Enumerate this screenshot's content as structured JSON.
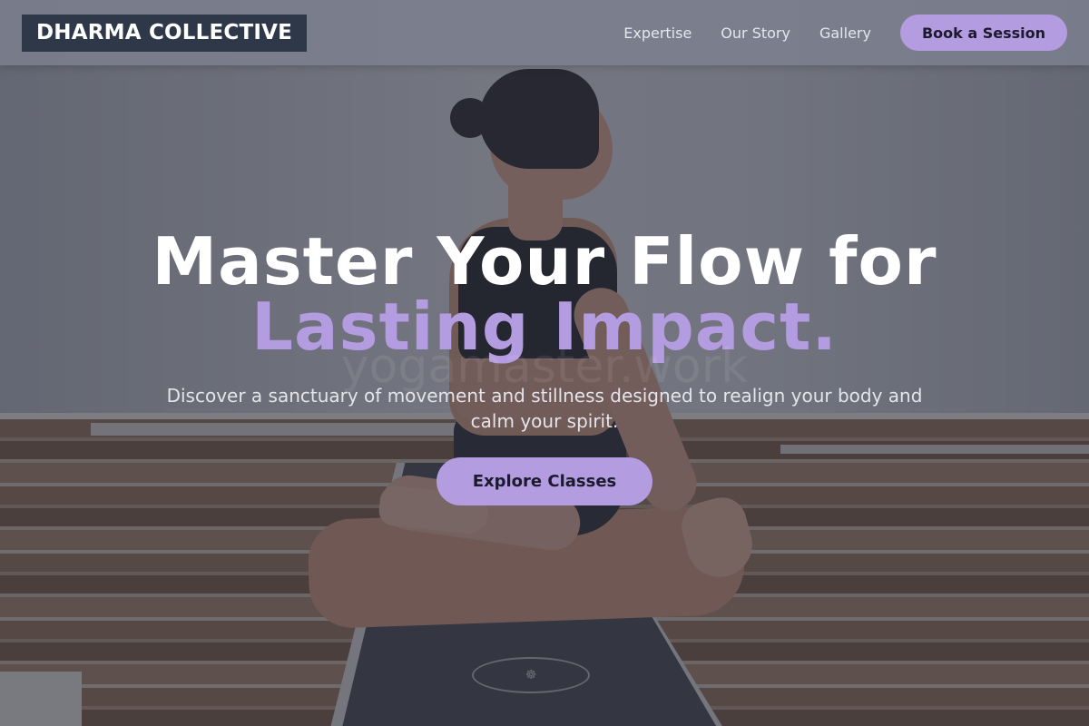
{
  "header": {
    "logo": "DHARMA COLLECTIVE",
    "nav": [
      "Expertise",
      "Our Story",
      "Gallery"
    ],
    "cta": "Book a Session"
  },
  "hero": {
    "title_line1": "Master Your Flow for",
    "title_line2": "Lasting Impact.",
    "watermark": "yogamaster.work",
    "subtitle": "Discover a sanctuary of movement and stillness designed to realign your body and calm your spirit.",
    "cta": "Explore Classes",
    "image_alt": "woman-meditating-on-yoga-mat"
  },
  "colors": {
    "accent": "#b49ce0",
    "logo_bg": "#2e3848",
    "button_text": "#1c1a2c"
  }
}
